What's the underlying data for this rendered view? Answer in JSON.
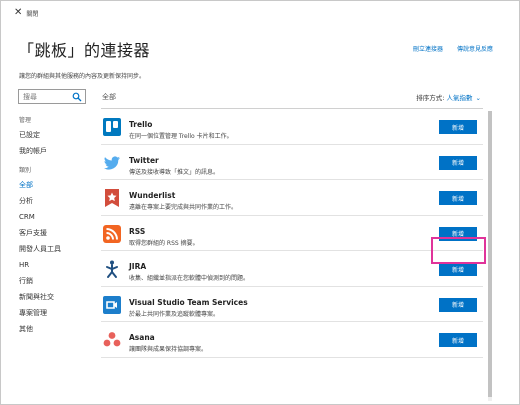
{
  "header": {
    "close_label": "關閉",
    "title": "「跳板」的連接器",
    "links": [
      "刪立連接器",
      "傳說意見反應"
    ]
  },
  "description": "讓您的群組與其他服務的內容及更新保持同步。",
  "search": {
    "placeholder": "搜尋"
  },
  "sidebar": {
    "manage_heading": "管理",
    "manage_items": [
      "已設定",
      "我的帳戶"
    ],
    "category_heading": "類別",
    "category_items": [
      "全部",
      "分析",
      "CRM",
      "客戶支援",
      "開發人員工具",
      "HR",
      "行銷",
      "新聞與社交",
      "專案管理",
      "其他"
    ]
  },
  "list_header": "全部",
  "sort": {
    "label": "排序方式: ",
    "value": "人氣指數"
  },
  "connectors": [
    {
      "name": "Trello",
      "description": "在同一個位置管理 Trello 卡片和工作。",
      "button": "新增",
      "icon": "trello-icon",
      "color": "#0079bf"
    },
    {
      "name": "Twitter",
      "description": "傳送及接收導致「推文」的訊息。",
      "button": "新增",
      "icon": "twitter-icon",
      "color": "#55acee"
    },
    {
      "name": "Wunderlist",
      "description": "遠離在專案上要完成與共同作業的工作。",
      "button": "新增",
      "icon": "wunderlist-icon",
      "color": "#d24d3c"
    },
    {
      "name": "RSS",
      "description": "取得您群組的 RSS 摘要。",
      "button": "新增",
      "icon": "rss-icon",
      "color": "#f26522"
    },
    {
      "name": "JIRA",
      "description": "收集、組織並指派在您軟體中偵測到的問題。",
      "button": "新增",
      "icon": "jira-icon",
      "color": "#205081"
    },
    {
      "name": "Visual Studio Team Services",
      "description": "於最上共同作業及追蹤軟體專案。",
      "button": "新增",
      "icon": "vsts-icon",
      "color": "#1c7ecb"
    },
    {
      "name": "Asana",
      "description": "讓團隊與成果保持協調專案。",
      "button": "新增",
      "icon": "asana-icon",
      "color": "#e8615b"
    }
  ],
  "colors": {
    "accent": "#0072c6",
    "highlight": "#e0339a"
  }
}
